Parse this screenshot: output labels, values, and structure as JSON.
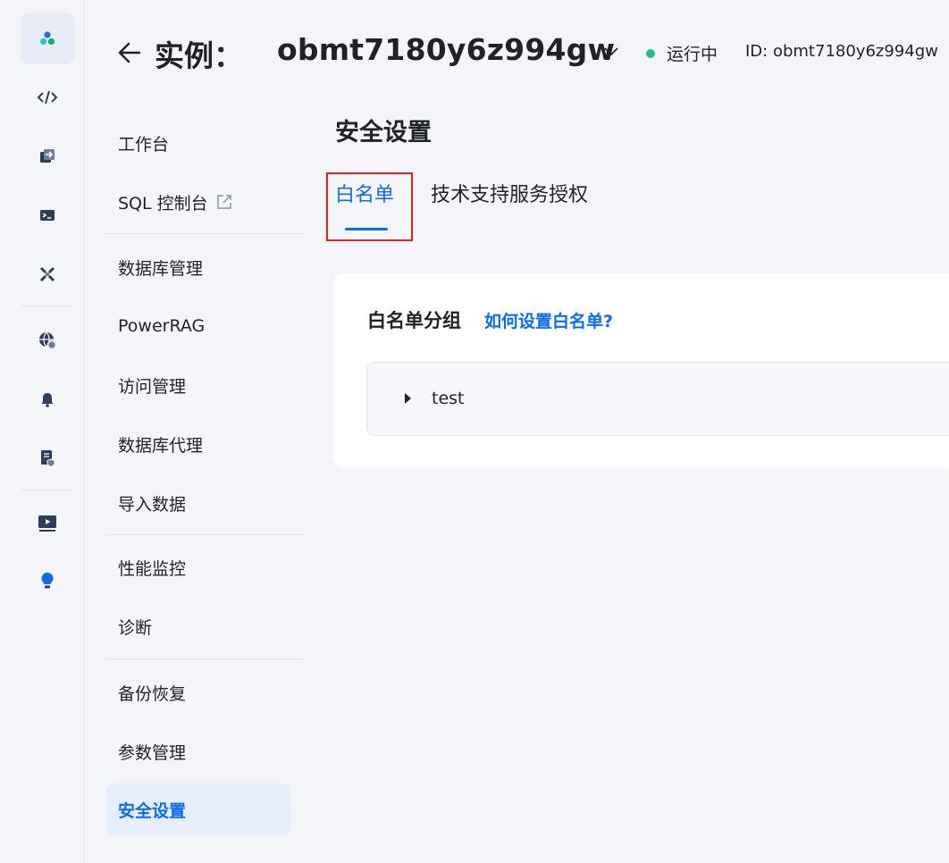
{
  "header": {
    "back_icon": "arrow-left-icon",
    "title_label": "实例：",
    "instance_name": "obmt7180y6z994gw",
    "dropdown_icon": "chevron-down-icon",
    "status": "运行中",
    "status_color": "#1ec28b",
    "id_text": "ID: obmt7180y6z994gw"
  },
  "rail": {
    "items": [
      {
        "icon": "cluster-logo-icon",
        "active": true
      },
      {
        "icon": "code-icon"
      },
      {
        "icon": "migration-icon"
      },
      {
        "icon": "terminal-icon"
      },
      {
        "icon": "tools-icon"
      },
      {
        "icon": "network-settings-icon"
      },
      {
        "icon": "bell-icon"
      },
      {
        "icon": "document-shield-icon"
      },
      {
        "icon": "video-play-icon"
      },
      {
        "icon": "lightbulb-icon"
      }
    ]
  },
  "nav": {
    "items": [
      {
        "label": "工作台"
      },
      {
        "label": "SQL 控制台",
        "icon": "external-link-icon"
      },
      {
        "label": "数据库管理"
      },
      {
        "label": "PowerRAG"
      },
      {
        "label": "访问管理"
      },
      {
        "label": "数据库代理"
      },
      {
        "label": "导入数据"
      },
      {
        "label": "性能监控"
      },
      {
        "label": "诊断"
      },
      {
        "label": "备份恢复"
      },
      {
        "label": "参数管理"
      },
      {
        "label": "安全设置",
        "active": true
      }
    ]
  },
  "main": {
    "title": "安全设置",
    "tabs": [
      {
        "label": "白名单",
        "active": true
      },
      {
        "label": "技术支持服务授权"
      }
    ],
    "card": {
      "title": "白名单分组",
      "help_link": "如何设置白名单?",
      "groups": [
        {
          "name": "test",
          "expanded": false
        }
      ]
    }
  },
  "colors": {
    "accent": "#0b6cf0",
    "highlight_border": "#e8201c",
    "background": "#f3f5f9"
  }
}
